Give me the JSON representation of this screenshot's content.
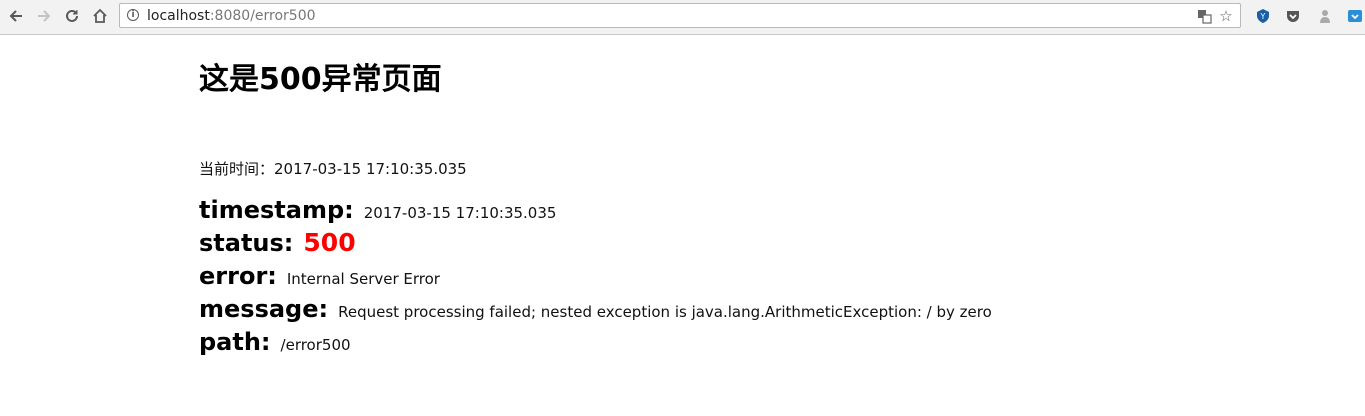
{
  "browser": {
    "url_host": "localhost",
    "url_path": ":8080/error500"
  },
  "page": {
    "heading": "这是500异常页面",
    "time_label": "当前时间：",
    "time_value": "2017-03-15 17:10:35.035",
    "fields": {
      "timestamp": {
        "label": "timestamp:",
        "value": "2017-03-15 17:10:35.035"
      },
      "status": {
        "label": "status:",
        "value": "500",
        "color": "#ff0000"
      },
      "error": {
        "label": "error:",
        "value": "Internal Server Error"
      },
      "message": {
        "label": "message:",
        "value": "Request processing failed; nested exception is java.lang.ArithmeticException: / by zero"
      },
      "path": {
        "label": "path:",
        "value": "/error500"
      }
    }
  }
}
